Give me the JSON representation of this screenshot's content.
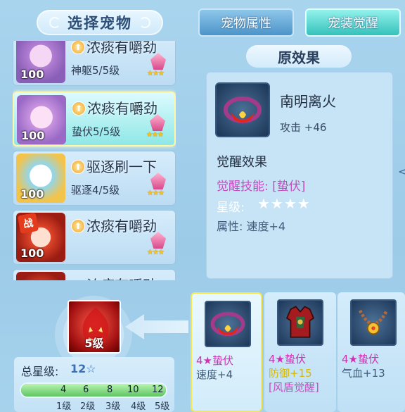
{
  "left_panel": {
    "title": "选择宠物"
  },
  "pets": [
    {
      "name": "浓痰有嚼劲",
      "stat": "神躯5/5级",
      "level": "100",
      "selected": false,
      "war": false
    },
    {
      "name": "浓痰有嚼劲",
      "stat": "蛰伏5/5级",
      "level": "100",
      "selected": true,
      "war": false
    },
    {
      "name": "驱逐刷一下",
      "stat": "驱逐4/5级",
      "level": "100",
      "selected": false,
      "war": false
    },
    {
      "name": "浓痰有嚼劲",
      "stat": "",
      "level": "100",
      "selected": false,
      "war": true,
      "war_label": "战"
    },
    {
      "name": "浓痰有嚼劲",
      "stat": "",
      "level": "",
      "selected": false,
      "war": false
    }
  ],
  "selected_portrait": {
    "level": "5级"
  },
  "summary": {
    "total_label": "总星级:",
    "total_value": "12☆",
    "progress": 1.0,
    "marks": [
      "4",
      "6",
      "8",
      "10",
      "12"
    ],
    "levels": [
      "1级",
      "2级",
      "3级",
      "4级",
      "5级"
    ]
  },
  "tabs": {
    "attributes": "宠物属性",
    "awaken": "宠装觉醒"
  },
  "effect": {
    "title": "原效果",
    "item_name": "南明离火",
    "item_stat": "攻击 +46",
    "section_title": "觉醒效果",
    "skill": "觉醒技能: [蛰伏]",
    "star_label": "星级:",
    "star_value": "★★★★",
    "attribute": "属性:  速度+4"
  },
  "equipment": [
    {
      "title": "4★蛰伏",
      "line1": "速度+4",
      "line2": "",
      "selected": true,
      "line1_color": "normal"
    },
    {
      "title": "4★蛰伏",
      "line1": "防御+15",
      "line2": "[风盾觉醒]",
      "selected": false,
      "line1_color": "yellow"
    },
    {
      "title": "4★蛰伏",
      "line1": "气血+13",
      "line2": "",
      "selected": false,
      "line1_color": "normal"
    }
  ],
  "side_arrow": "<"
}
